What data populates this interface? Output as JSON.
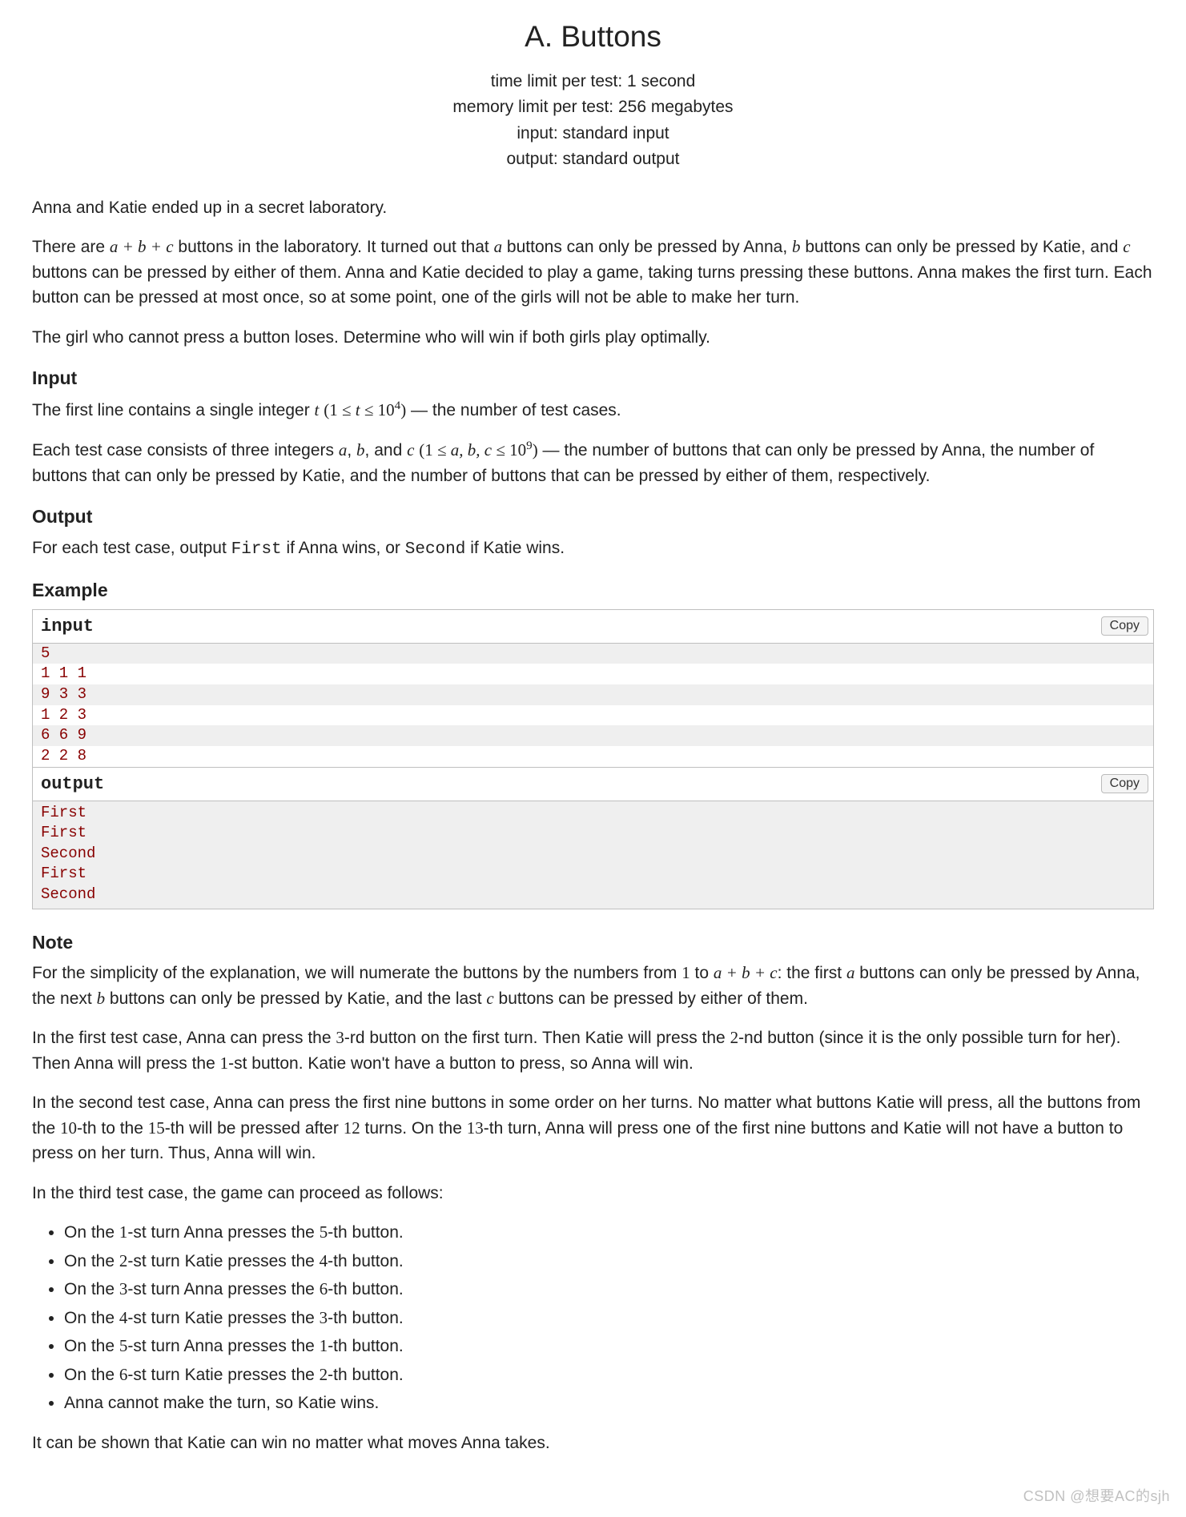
{
  "title": "A. Buttons",
  "meta": {
    "time": "time limit per test: 1 second",
    "memory": "memory limit per test: 256 megabytes",
    "input": "input: standard input",
    "output": "output: standard output"
  },
  "intro1": "Anna and Katie ended up in a secret laboratory.",
  "intro2a": "There are ",
  "intro2b": " buttons in the laboratory. It turned out that ",
  "intro2c": " buttons can only be pressed by Anna, ",
  "intro2d": " buttons can only be pressed by Katie, and ",
  "intro2e": " buttons can be pressed by either of them. Anna and Katie decided to play a game, taking turns pressing these buttons. Anna makes the first turn. Each button can be pressed at most once, so at some point, one of the girls will not be able to make her turn.",
  "intro3": "The girl who cannot press a button loses. Determine who will win if both girls play optimally.",
  "input_h": "Input",
  "input_p1a": "The first line contains a single integer ",
  "input_p1b": " — the number of test cases.",
  "input_p2a": "Each test case consists of three integers ",
  "input_p2b": ", and ",
  "input_p2c": " — the number of buttons that can only be pressed by Anna, the number of buttons that can only be pressed by Katie, and the number of buttons that can be pressed by either of them, respectively.",
  "output_h": "Output",
  "output_p_a": "For each test case, output ",
  "output_p_b": " if Anna wins, or ",
  "output_p_c": " if Katie wins.",
  "first_lit": "First",
  "second_lit": "Second",
  "example_h": "Example",
  "io": {
    "input_label": "input",
    "output_label": "output",
    "copy": "Copy",
    "input_lines": [
      "5",
      "1 1 1",
      "9 3 3",
      "1 2 3",
      "6 6 9",
      "2 2 8"
    ],
    "output_text": "First\nFirst\nSecond\nFirst\nSecond"
  },
  "note_h": "Note",
  "note1a": "For the simplicity of the explanation, we will numerate the buttons by the numbers from ",
  "note1b": " to ",
  "note1c": ": the first ",
  "note1d": " buttons can only be pressed by Anna, the next ",
  "note1e": " buttons can only be pressed by Katie, and the last ",
  "note1f": " buttons can be pressed by either of them.",
  "note2a": "In the first test case, Anna can press the ",
  "note2b": "-rd button on the first turn. Then Katie will press the ",
  "note2c": "-nd button (since it is the only possible turn for her). Then Anna will press the ",
  "note2d": "-st button. Katie won't have a button to press, so Anna will win.",
  "note3a": "In the second test case, Anna can press the first nine buttons in some order on her turns. No matter what buttons Katie will press, all the buttons from the ",
  "note3b": "-th to the ",
  "note3c": "-th will be pressed after ",
  "note3d": " turns. On the ",
  "note3e": "-th turn, Anna will press one of the first nine buttons and Katie will not have a button to press on her turn. Thus, Anna will win.",
  "note4": "In the third test case, the game can proceed as follows:",
  "steps": [
    {
      "a": "On the ",
      "n1": "1",
      "b": "-st turn Anna presses the ",
      "n2": "5",
      "c": "-th button."
    },
    {
      "a": "On the ",
      "n1": "2",
      "b": "-st turn Katie presses the ",
      "n2": "4",
      "c": "-th button."
    },
    {
      "a": "On the ",
      "n1": "3",
      "b": "-st turn Anna presses the ",
      "n2": "6",
      "c": "-th button."
    },
    {
      "a": "On the ",
      "n1": "4",
      "b": "-st turn Katie presses the ",
      "n2": "3",
      "c": "-th button."
    },
    {
      "a": "On the ",
      "n1": "5",
      "b": "-st turn Anna presses the ",
      "n2": "1",
      "c": "-th button."
    },
    {
      "a": "On the ",
      "n1": "6",
      "b": "-st turn Katie presses the ",
      "n2": "2",
      "c": "-th button."
    }
  ],
  "step_last": "Anna cannot make the turn, so Katie wins.",
  "note5": "It can be shown that Katie can win no matter what moves Anna takes.",
  "nums": {
    "n1": "1",
    "n2": "2",
    "n3": "3",
    "n10": "10",
    "n12": "12",
    "n13": "13",
    "n15": "15"
  },
  "expr": {
    "abc": "a + b + c",
    "a": "a",
    "b": "b",
    "c": "c",
    "t": "t",
    "t_rng_a": "(1 ≤ ",
    "t_rng_b": " ≤ 10",
    "t_exp": "4",
    "t_rng_c": ")",
    "abc_rng_a": "(1 ≤ ",
    "abc_rng_b": " ≤ 10",
    "abc_exp": "9",
    "abc_rng_c": ")",
    "abc_list": "a, b, c",
    "sep": ", "
  },
  "watermark": "CSDN @想要AC的sjh"
}
